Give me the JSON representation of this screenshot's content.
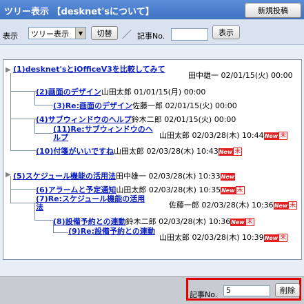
{
  "header": {
    "title": "ツリー表示 【desknet'sについて】",
    "new_post_label": "新規投稿"
  },
  "toolbar": {
    "display_label": "表示",
    "view_select_value": "ツリー表示",
    "switch_label": "切替",
    "separator": "／",
    "article_no_label": "記事No.",
    "article_no_value": "",
    "show_label": "表示"
  },
  "threads": [
    {
      "posts": [
        {
          "title": "(1)desknet'sとiOfficeV3を比較してみて",
          "author": "田中雄一",
          "date": "02/01/15(火) 00:00",
          "new": false,
          "unread": false
        },
        {
          "title": "(2)画面のデザイン",
          "author": "山田太郎",
          "date": "01/01/15(月) 00:00",
          "new": false,
          "unread": false
        },
        {
          "title": "(3)Re:画面のデザイン",
          "author": "佐藤一郎",
          "date": "02/01/15(火) 00:00",
          "new": false,
          "unread": false
        },
        {
          "title": "(4)サブウィンドウのヘルプ",
          "author": "鈴木二郎",
          "date": "02/01/15(火) 00:00",
          "new": false,
          "unread": false
        },
        {
          "title": "(11)Re:サブウィンドウのヘルプ",
          "author": "山田太郎",
          "date": "02/03/28(木) 10:44",
          "new": true,
          "unread": true
        },
        {
          "title": "(10)付箋がいいですね",
          "author": "山田太郎",
          "date": "02/03/28(木) 10:43",
          "new": true,
          "unread": true
        }
      ]
    },
    {
      "posts": [
        {
          "title": "(5)スケジュール機能の活用法",
          "author": "田中雄一",
          "date": "02/03/28(木) 10:33",
          "new": true,
          "unread": false
        },
        {
          "title": "(6)アラームと予定通知",
          "author": "山田太郎",
          "date": "02/03/28(木) 10:35",
          "new": true,
          "unread": true
        },
        {
          "title": "(7)Re:スケジュール機能の活用法",
          "author": "佐藤一郎",
          "date": "02/03/28(木) 10:36",
          "new": true,
          "unread": true
        },
        {
          "title": "(8)設備予約との連動",
          "author": "鈴木二郎",
          "date": "02/03/28(木) 10:36",
          "new": true,
          "unread": true
        },
        {
          "title": "(9)Re:設備予約との連動",
          "author": "山田太郎",
          "date": "02/03/28(木) 10:39",
          "new": true,
          "unread": true
        }
      ]
    }
  ],
  "badges": {
    "new_label": "New",
    "unread_label": "未"
  },
  "footer": {
    "article_no_label": "記事No.",
    "article_no_value": "5",
    "delete_label": "削除"
  }
}
